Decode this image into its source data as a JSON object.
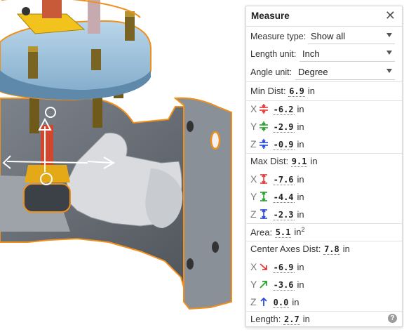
{
  "viewport": {
    "description_icon": "valve-assembly-3d-model"
  },
  "panel": {
    "title": "Measure",
    "close_icon": "close-icon",
    "measure_type": {
      "label": "Measure type:",
      "value": "Show all"
    },
    "length_unit": {
      "label": "Length unit:",
      "value": "Inch"
    },
    "angle_unit": {
      "label": "Angle unit:",
      "value": "Degree"
    },
    "min_dist": {
      "label": "Min Dist:",
      "value": "6.9",
      "unit": "in"
    },
    "min_x": {
      "axis": "X",
      "value": "-6.2",
      "unit": "in",
      "color": "#e23a3a"
    },
    "min_y": {
      "axis": "Y",
      "value": "-2.9",
      "unit": "in",
      "color": "#2aa02a"
    },
    "min_z": {
      "axis": "Z",
      "value": "-0.9",
      "unit": "in",
      "color": "#2b49d6"
    },
    "max_dist": {
      "label": "Max Dist:",
      "value": "9.1",
      "unit": "in"
    },
    "max_x": {
      "axis": "X",
      "value": "-7.6",
      "unit": "in",
      "color": "#e23a3a"
    },
    "max_y": {
      "axis": "Y",
      "value": "-4.4",
      "unit": "in",
      "color": "#2aa02a"
    },
    "max_z": {
      "axis": "Z",
      "value": "-2.3",
      "unit": "in",
      "color": "#2b49d6"
    },
    "area": {
      "label": "Area:",
      "value": "5.1",
      "unit": "in",
      "sup": "2"
    },
    "center_axes": {
      "label": "Center Axes Dist:",
      "value": "7.8",
      "unit": "in"
    },
    "center_x": {
      "axis": "X",
      "value": "-6.9",
      "unit": "in",
      "color": "#e23a3a"
    },
    "center_y": {
      "axis": "Y",
      "value": "-3.6",
      "unit": "in",
      "color": "#2aa02a"
    },
    "center_z": {
      "axis": "Z",
      "value": "0.0",
      "unit": "in",
      "color": "#2b49d6"
    },
    "length": {
      "label": "Length:",
      "value": "2.7",
      "unit": "in"
    },
    "help_icon": "?"
  }
}
